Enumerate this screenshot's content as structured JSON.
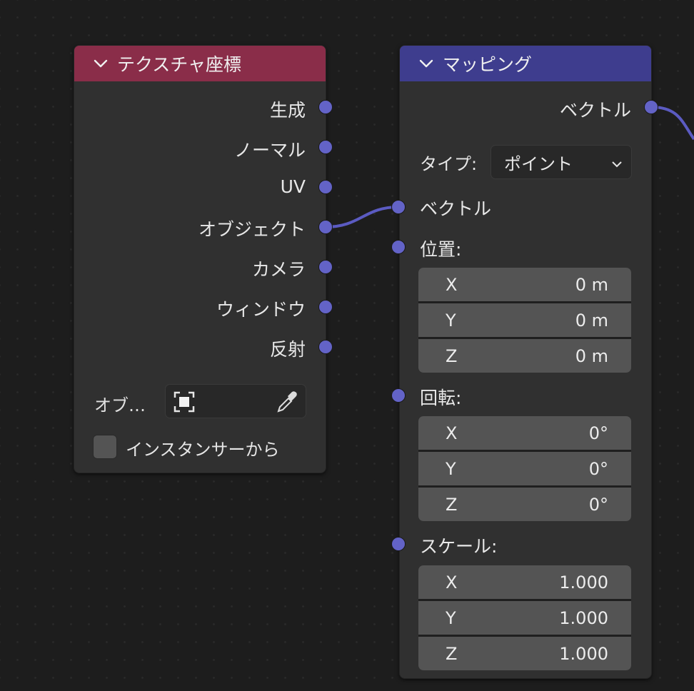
{
  "texture_node": {
    "title": "テクスチャ座標",
    "header_color": "#8a2d49",
    "outputs": [
      "生成",
      "ノーマル",
      "UV",
      "オブジェクト",
      "カメラ",
      "ウィンドウ",
      "反射"
    ],
    "object_label": "オブ…",
    "instancer_label": "インスタンサーから"
  },
  "mapping_node": {
    "title": "マッピング",
    "header_color": "#3e3d8e",
    "output_vector": "ベクトル",
    "type_label": "タイプ:",
    "type_value": "ポイント",
    "input_vector": "ベクトル",
    "location": {
      "label": "位置:",
      "x": "0 m",
      "y": "0 m",
      "z": "0 m"
    },
    "rotation": {
      "label": "回転:",
      "x": "0°",
      "y": "0°",
      "z": "0°"
    },
    "scale": {
      "label": "スケール:",
      "x": "1.000",
      "y": "1.000",
      "z": "1.000"
    },
    "axis_x": "X",
    "axis_y": "Y",
    "axis_z": "Z"
  },
  "socket_color": "#6363c7",
  "link_color": "#5b5bc2"
}
